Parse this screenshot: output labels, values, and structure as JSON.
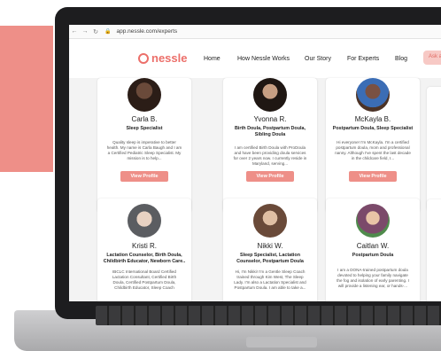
{
  "browser": {
    "url": "app.nessle.com/experts"
  },
  "header": {
    "logo": "nessle",
    "nav": [
      "Home",
      "How Nessle Works",
      "Our Story",
      "For Experts",
      "Blog"
    ],
    "cta_label": "Ask a"
  },
  "experts": [
    {
      "name": "Carla B.",
      "role": "Sleep Specialist",
      "bio": "Quality sleep is imperative to better health. My name is Carla Baugh and I am a Certified Pediatric Sleep Specialist. My mission is to help...",
      "button": "View Profile"
    },
    {
      "name": "Yvonna R.",
      "role": "Birth Doula, Postpartum Doula, Sibling Doula",
      "bio": "I am certified Birth Doula with ProDoula and have been providing doula services for over 2 years now. I currently reside in Maryland, serving...",
      "button": "View Profile"
    },
    {
      "name": "McKayla B.",
      "role": "Postpartum Doula, Sleep Specialist",
      "bio": "Hi everyone! I'm McKayla. I'm a certified postpartum doula, mom and professional nanny. Although I've spent the last decade in the childcare field, I...",
      "button": "View Profile"
    },
    {
      "name": "Kristi R.",
      "role": "Lactation Counselor, Birth Doula, Childbirth Educator, Newborn Care..",
      "bio": "IBCLC International Board Certified Lactation Consultant, Certified Birth Doula, Certified Postpartum Doula, Childbirth Educator, Sleep Coach",
      "button": ""
    },
    {
      "name": "Nikki W.",
      "role": "Sleep Specialist, Lactation Counselor, Postpartum Doula",
      "bio": "Hi, I'm Nikki! I'm a Gentle Sleep Coach trained through Kim West, The Sleep Lady. I'm also a Lactation Specialist and Postpartum Doula. I am able to take a...",
      "button": ""
    },
    {
      "name": "Caitlan W.",
      "role": "Postpartum Doula",
      "bio": "I am a DONA-trained postpartum doula devoted to helping your family navigate the fog and isolation of early parenting. I will provide a listening ear, or hands-...",
      "button": ""
    }
  ],
  "colors": {
    "accent": "#ee8f88",
    "logo": "#ec6f6a",
    "cta_bg": "#f7c9c5"
  }
}
